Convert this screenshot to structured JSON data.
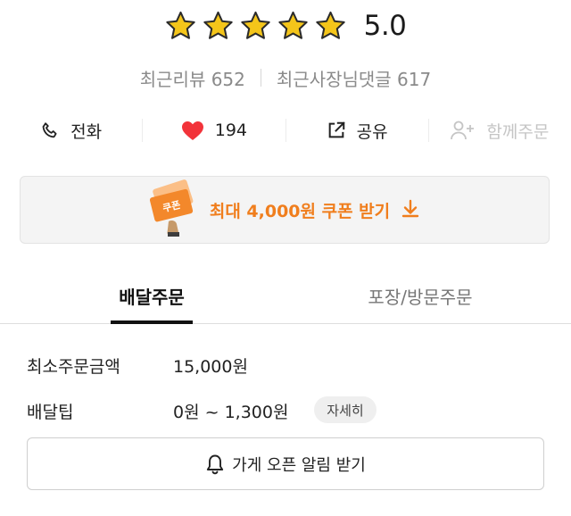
{
  "rating": {
    "stars": 5,
    "value": "5.0",
    "star_color": "#f4c51a"
  },
  "reviews": {
    "recent_reviews": "최근리뷰 652",
    "owner_comments": "최근사장님댓글 617"
  },
  "actions": [
    {
      "label": "전화",
      "icon": "phone-icon"
    },
    {
      "label": "194",
      "icon": "heart-icon",
      "icon_color": "#f2333a"
    },
    {
      "label": "공유",
      "icon": "share-icon"
    },
    {
      "label": "함께주문",
      "icon": "add-person-icon",
      "disabled": true
    }
  ],
  "coupon": {
    "label": "최대 4,000원 쿠폰 받기",
    "ticket_text": "쿠폰",
    "accent": "#f07e1d"
  },
  "tabs": [
    {
      "label": "배달주문",
      "active": true
    },
    {
      "label": "포장/방문주문",
      "active": false
    }
  ],
  "info": {
    "min_order_label": "최소주문금액",
    "min_order_value": "15,000원",
    "tip_label": "배달팁",
    "tip_value": "0원 ~ 1,300원",
    "detail_button": "자세히"
  },
  "notify_button": "가게 오픈 알림 받기"
}
